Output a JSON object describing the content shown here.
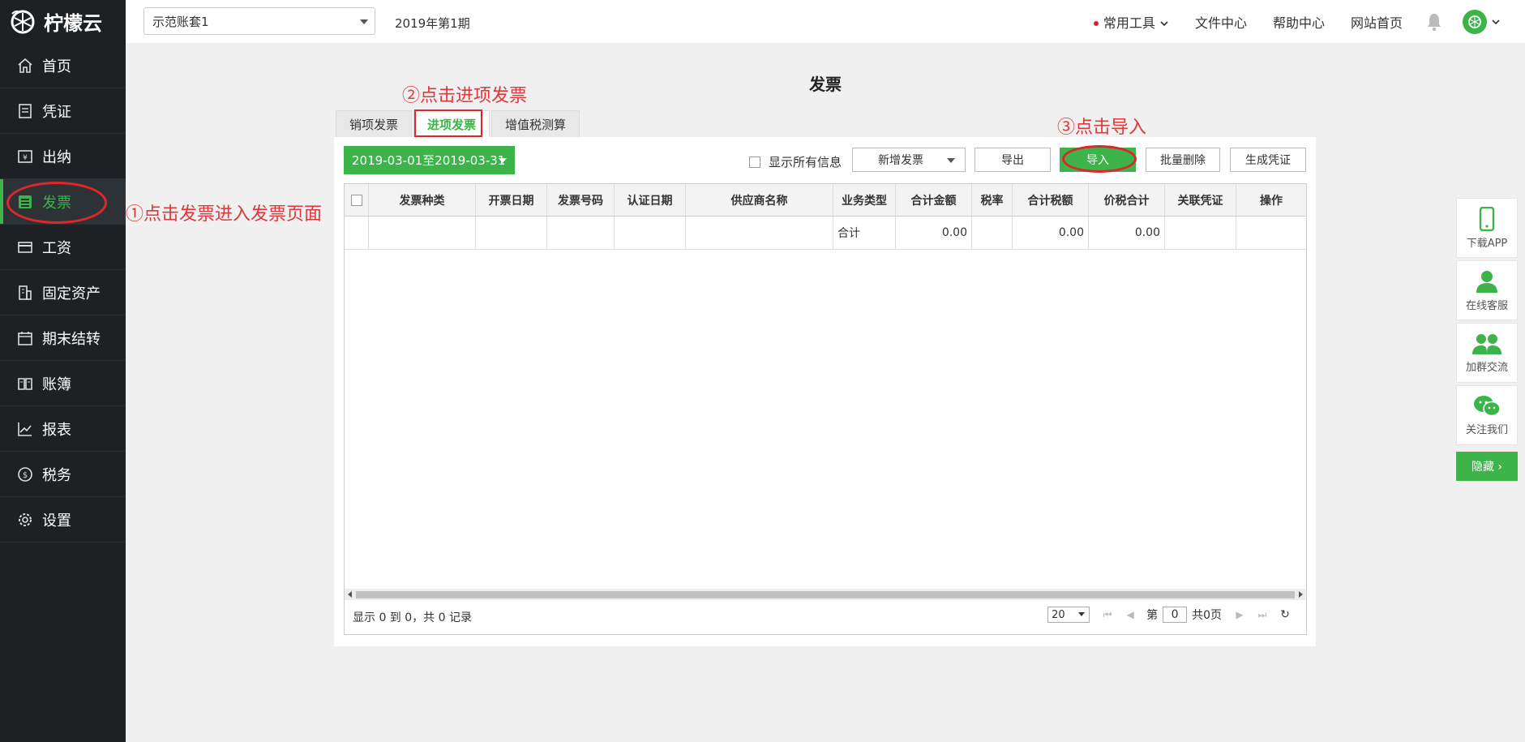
{
  "app": {
    "name": "柠檬云"
  },
  "sidebar": {
    "items": [
      {
        "label": "首页",
        "icon": "home-icon"
      },
      {
        "label": "凭证",
        "icon": "voucher-icon"
      },
      {
        "label": "出纳",
        "icon": "cashier-icon"
      },
      {
        "label": "发票",
        "icon": "invoice-icon",
        "active": true
      },
      {
        "label": "工资",
        "icon": "salary-icon"
      },
      {
        "label": "固定资产",
        "icon": "building-icon"
      },
      {
        "label": "期末结转",
        "icon": "calendar-icon"
      },
      {
        "label": "账簿",
        "icon": "book-icon"
      },
      {
        "label": "报表",
        "icon": "chart-icon"
      },
      {
        "label": "税务",
        "icon": "tax-icon"
      },
      {
        "label": "设置",
        "icon": "gear-icon"
      }
    ]
  },
  "topbar": {
    "account": "示范账套1",
    "period": "2019年第1期",
    "tools": "常用工具",
    "files": "文件中心",
    "help": "帮助中心",
    "home": "网站首页"
  },
  "page": {
    "title": "发票",
    "tabs": [
      "销项发票",
      "进项发票",
      "增值税测算"
    ],
    "active_tab": 1,
    "date_range": "2019-03-01至2019-03-31",
    "show_all": "显示所有信息",
    "buttons": {
      "add": "新增发票",
      "export": "导出",
      "import": "导入",
      "batch_delete": "批量删除",
      "gen_voucher": "生成凭证"
    }
  },
  "table": {
    "columns": [
      "发票种类",
      "开票日期",
      "发票号码",
      "认证日期",
      "供应商名称",
      "业务类型",
      "合计金额",
      "税率",
      "合计税额",
      "价税合计",
      "关联凭证",
      "操作"
    ],
    "total_row": {
      "label": "合计",
      "amount": "0.00",
      "tax": "0.00",
      "total": "0.00"
    },
    "summary": "显示 0 到 0，共 0 记录",
    "page_size": "20",
    "page_prefix": "第",
    "page_no": "0",
    "page_total": "共0页"
  },
  "annotations": {
    "step1": "①点击发票进入发票页面",
    "step2": "②点击进项发票",
    "step3": "③点击导入"
  },
  "float_panel": {
    "items": [
      "下载APP",
      "在线客服",
      "加群交流",
      "关注我们"
    ],
    "hide": "隐藏 ›"
  },
  "colors": {
    "accent": "#3cb44a",
    "sidebar": "#1e2124",
    "annotation": "#e0373a"
  }
}
